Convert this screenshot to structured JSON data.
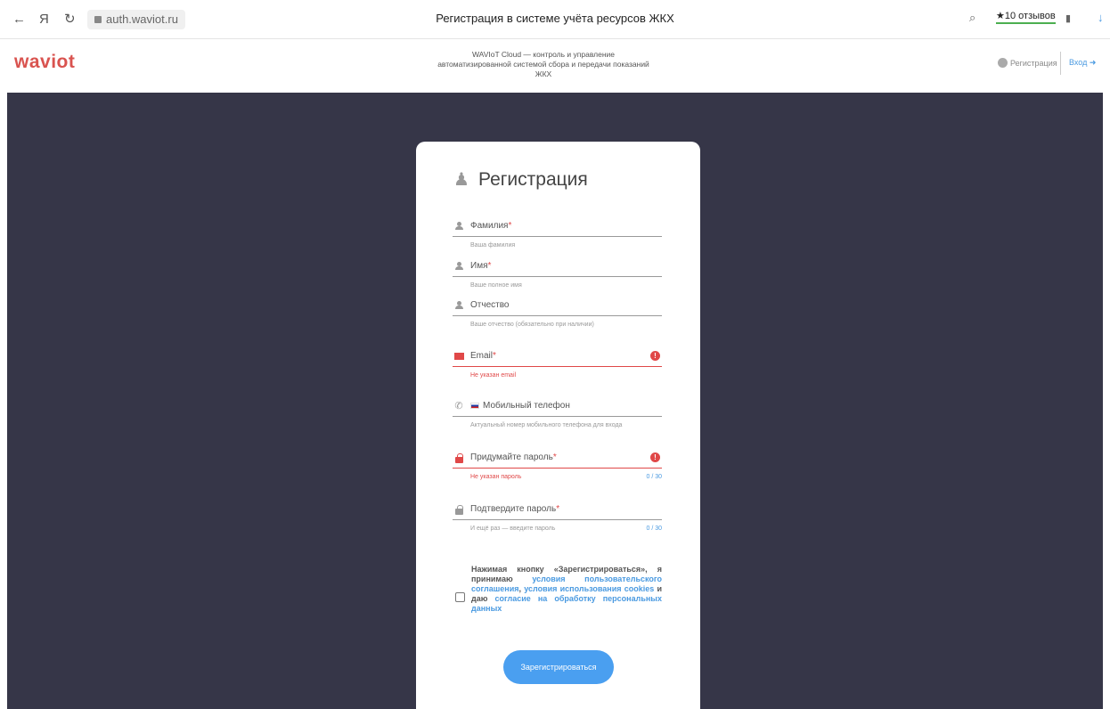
{
  "browser": {
    "back_icon": "←",
    "yandex_icon": "Я",
    "reload_icon": "↻",
    "url": "auth.waviot.ru",
    "page_title": "Регистрация в системе учёта ресурсов ЖКХ",
    "search_icon": "⌕",
    "reviews": "★10 отзывов",
    "bookmark_icon": "▮",
    "download_icon": "↓"
  },
  "header": {
    "logo": "waviot",
    "tagline_line1": "WAVIoT Cloud — контроль и управление",
    "tagline_line2": "автоматизированной системой сбора и передачи показаний",
    "tagline_line3": "ЖКХ",
    "register_link": "Регистрация",
    "login_link": "Вход",
    "login_icon": "➜"
  },
  "form": {
    "title": "Регистрация",
    "title_icon": "person-add-icon",
    "fields": [
      {
        "label": "Фамилия",
        "required": "*",
        "hint": "Ваша фамилия"
      },
      {
        "label": "Имя",
        "required": "*",
        "hint": "Ваше полное имя"
      },
      {
        "label": "Отчество",
        "required": "",
        "hint": "Ваше отчество (обязательно при наличии)"
      },
      {
        "label": "Email",
        "required": "*",
        "hint": "Не указан email",
        "error_icon": "!"
      },
      {
        "label": "Мобильный телефон",
        "required": "",
        "hint": "Актуальный номер мобильного телефона для входа"
      },
      {
        "label": "Придумайте пароль",
        "required": "*",
        "hint": "Не указан пароль",
        "counter": "0 / 30",
        "error_icon": "!"
      },
      {
        "label": "Подтвердите пароль",
        "required": "*",
        "hint": "И ещё раз — введите пароль",
        "counter": "0 / 30"
      }
    ],
    "phone_icon": "✆",
    "consent": {
      "text1": "Нажимая кнопку «Зарегистрироваться», я принимаю ",
      "link1": "условия пользовательского соглашения",
      "sep": ", ",
      "link2": "условия использования cookies",
      "text2": " и даю ",
      "link3": "согласие на обработку персональных данных"
    },
    "submit_label": "Зарегистрироваться"
  },
  "colors": {
    "accent": "#4a9ff0",
    "error": "#e04848",
    "background": "#363648",
    "logo": "#d9534f"
  }
}
